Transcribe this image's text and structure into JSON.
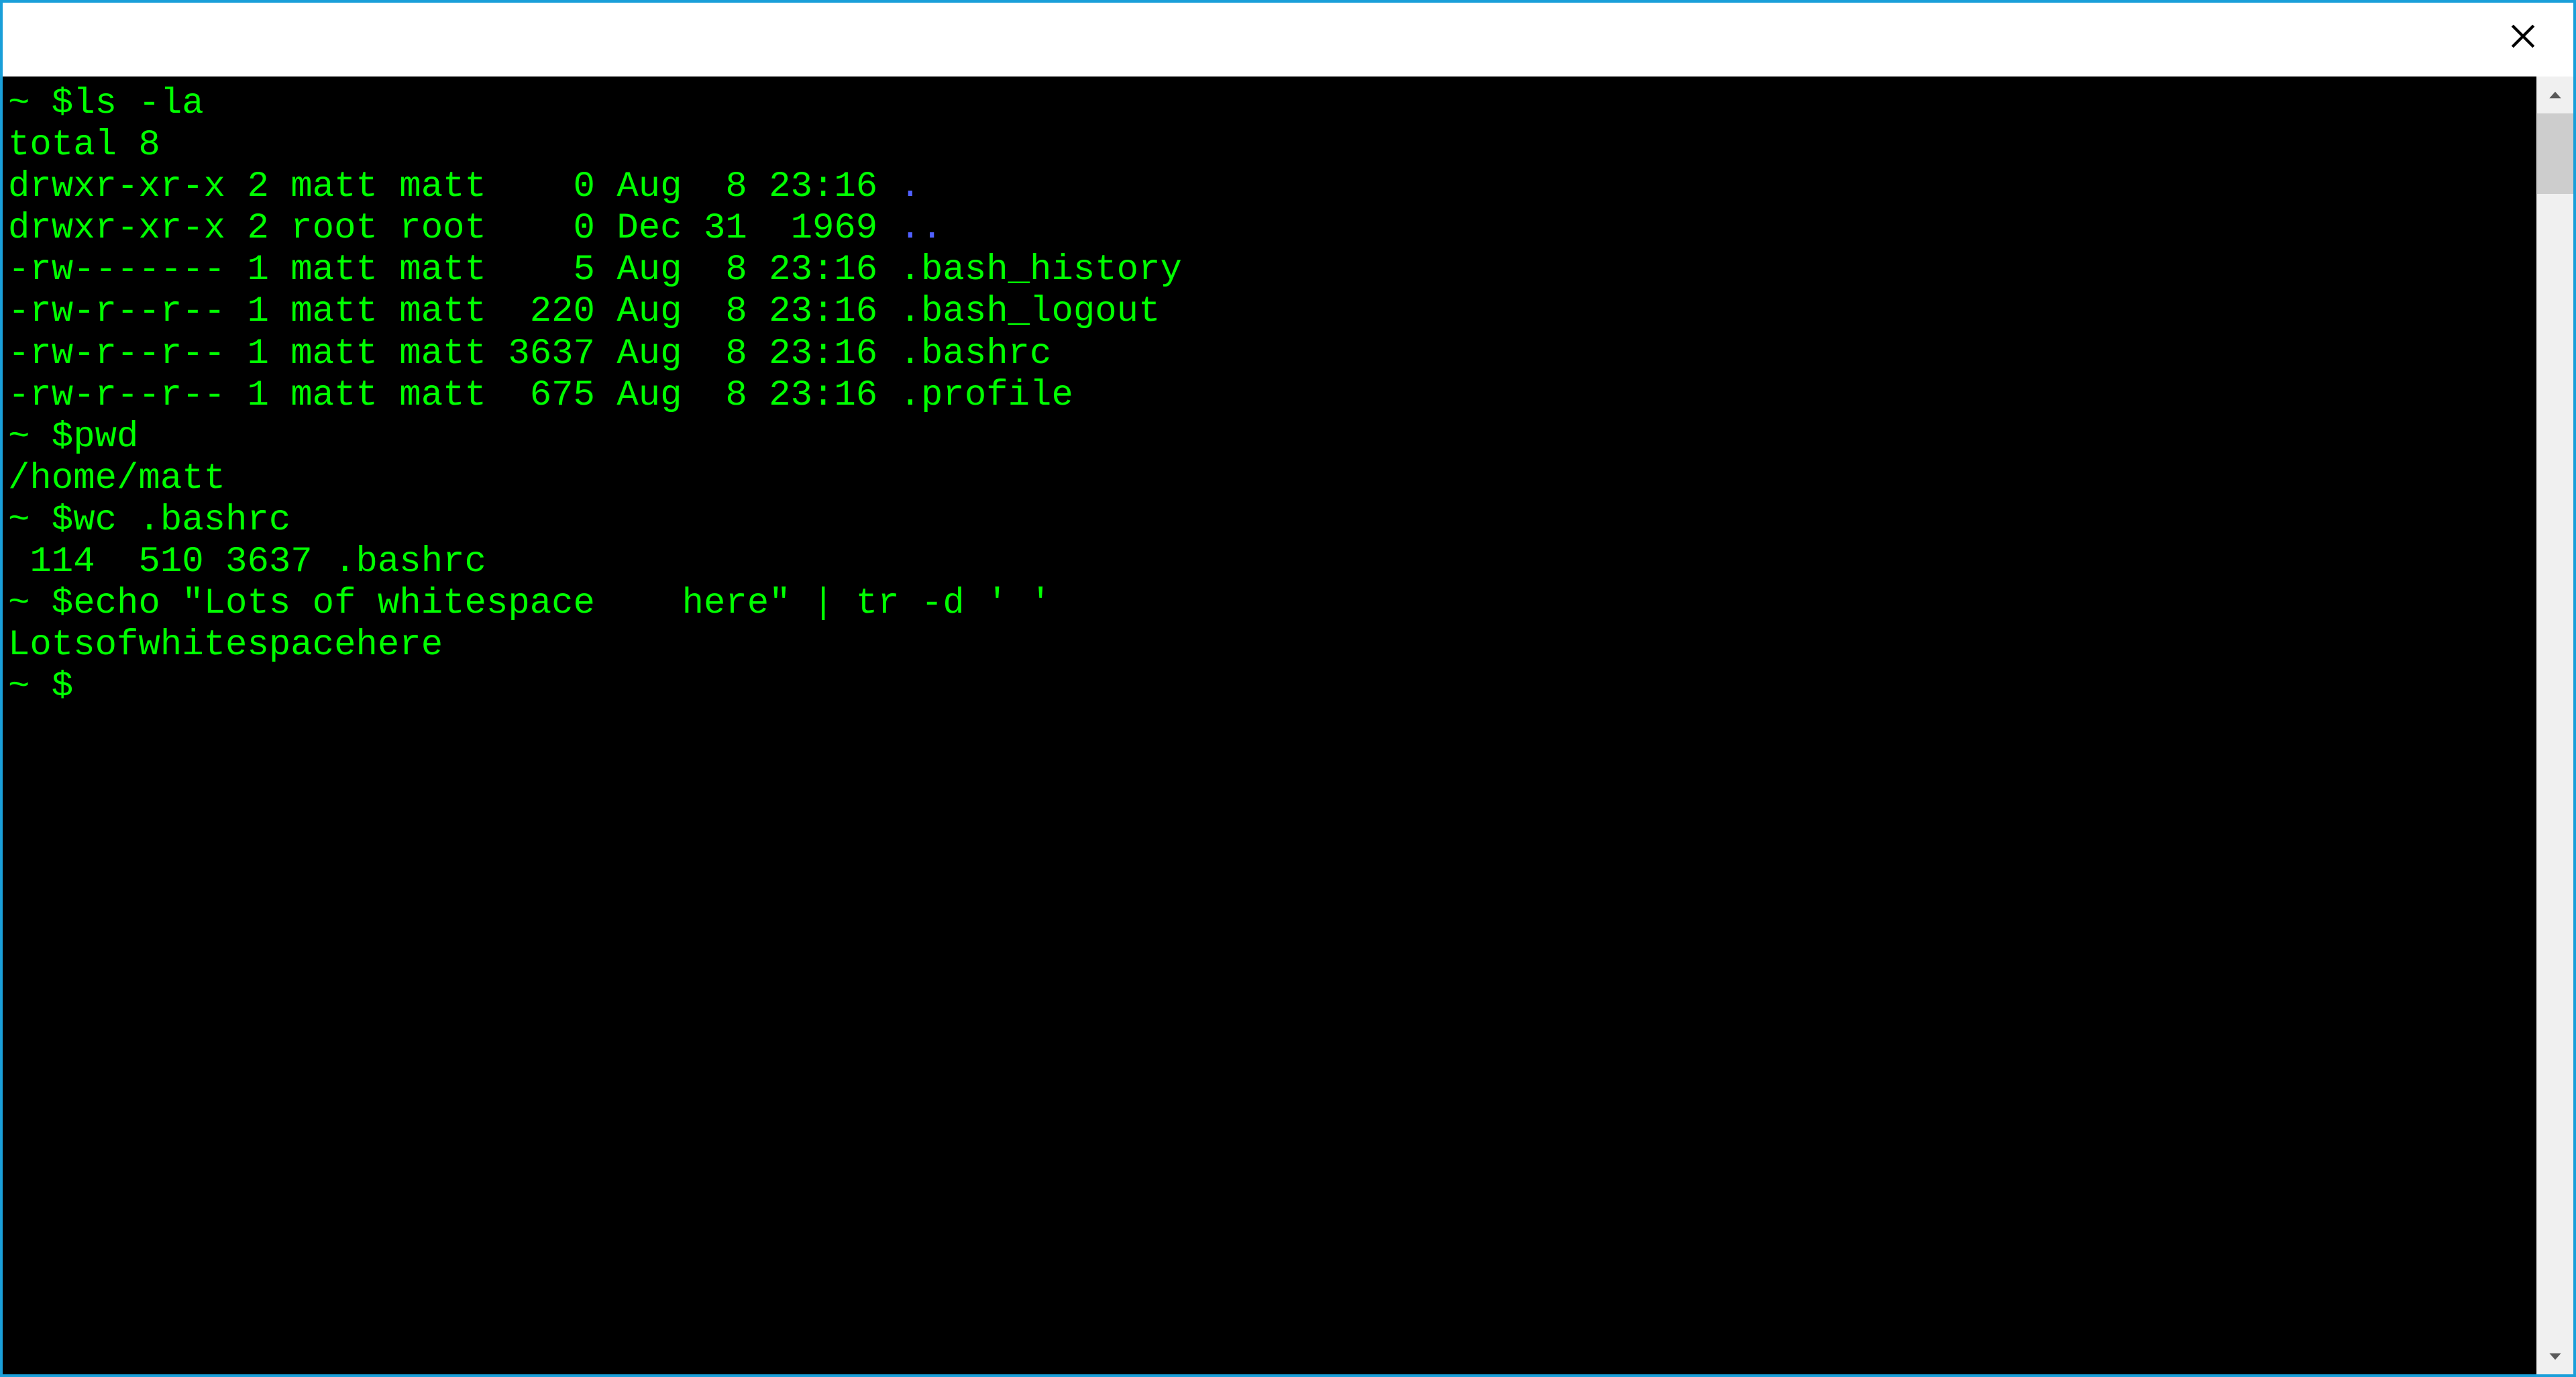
{
  "prompt": {
    "tilde": "~",
    "sep": " $"
  },
  "titlebar": {
    "close_title": "Close"
  },
  "session": {
    "cmd1": "ls -la",
    "ls": {
      "total_line": "total 8",
      "rows": [
        {
          "perm": "drwxr-xr-x",
          "links": "2",
          "owner": "matt",
          "group": "matt",
          "size": "0",
          "s_pad": "   ",
          "month": "Aug",
          "day": " 8",
          "time": "23:16",
          "name": ".",
          "is_dir": true
        },
        {
          "perm": "drwxr-xr-x",
          "links": "2",
          "owner": "root",
          "group": "root",
          "size": "0",
          "s_pad": "   ",
          "month": "Dec",
          "day": "31",
          "time": " 1969",
          "name": "..",
          "is_dir": true
        },
        {
          "perm": "-rw-------",
          "links": "1",
          "owner": "matt",
          "group": "matt",
          "size": "5",
          "s_pad": "   ",
          "month": "Aug",
          "day": " 8",
          "time": "23:16",
          "name": ".bash_history",
          "is_dir": false
        },
        {
          "perm": "-rw-r--r--",
          "links": "1",
          "owner": "matt",
          "group": "matt",
          "size": "220",
          "s_pad": " ",
          "month": "Aug",
          "day": " 8",
          "time": "23:16",
          "name": ".bash_logout",
          "is_dir": false
        },
        {
          "perm": "-rw-r--r--",
          "links": "1",
          "owner": "matt",
          "group": "matt",
          "size": "3637",
          "s_pad": "",
          "month": "Aug",
          "day": " 8",
          "time": "23:16",
          "name": ".bashrc",
          "is_dir": false
        },
        {
          "perm": "-rw-r--r--",
          "links": "1",
          "owner": "matt",
          "group": "matt",
          "size": "675",
          "s_pad": " ",
          "month": "Aug",
          "day": " 8",
          "time": "23:16",
          "name": ".profile",
          "is_dir": false
        }
      ]
    },
    "cmd2": "pwd",
    "pwd_out": "/home/matt",
    "cmd3": "wc .bashrc",
    "wc_out": " 114  510 3637 .bashrc",
    "cmd4": "echo \"Lots of whitespace    here\" | tr -d ' '",
    "echo_out": "Lotsofwhitespacehere"
  }
}
